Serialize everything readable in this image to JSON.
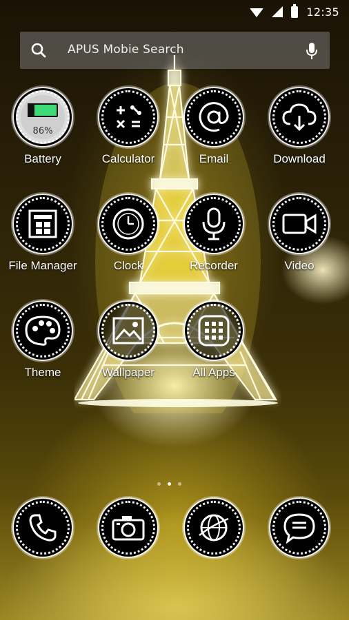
{
  "status_bar": {
    "time": "12:35",
    "icons": [
      "wifi-icon",
      "signal-icon",
      "battery-icon"
    ]
  },
  "search": {
    "placeholder": "APUS Mobie Search"
  },
  "apps": [
    {
      "label": "Battery",
      "icon": "battery-icon",
      "percent": "86%"
    },
    {
      "label": "Calculator",
      "icon": "calculator-icon"
    },
    {
      "label": "Email",
      "icon": "at-sign-icon"
    },
    {
      "label": "Download",
      "icon": "cloud-download-icon"
    },
    {
      "label": "File Manager",
      "icon": "file-manager-icon"
    },
    {
      "label": "Clock",
      "icon": "clock-icon"
    },
    {
      "label": "Recorder",
      "icon": "microphone-icon"
    },
    {
      "label": "Video",
      "icon": "video-camera-icon"
    },
    {
      "label": "Theme",
      "icon": "palette-icon"
    },
    {
      "label": "Wallpaper",
      "icon": "image-icon"
    },
    {
      "label": "All Apps",
      "icon": "app-grid-icon"
    }
  ],
  "dock": [
    {
      "icon": "phone-icon"
    },
    {
      "icon": "camera-icon"
    },
    {
      "icon": "globe-icon"
    },
    {
      "icon": "chat-bubble-icon"
    }
  ],
  "pager": {
    "pages": 3,
    "active": 2
  },
  "colors": {
    "battery_green": "#3fd97a",
    "glow": "#fff6a0"
  }
}
